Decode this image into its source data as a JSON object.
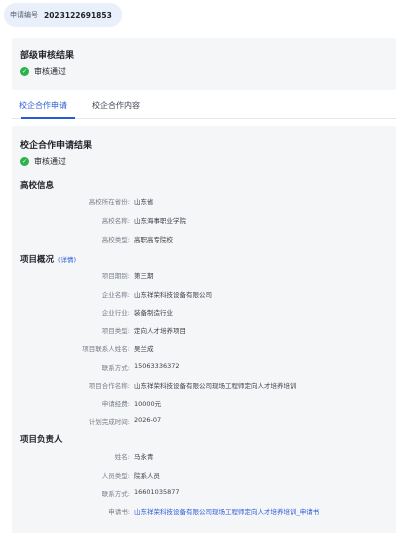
{
  "header": {
    "app_label": "申请编号",
    "app_number": "2023122691853"
  },
  "dept_review": {
    "title": "部级审核结果",
    "status": "审核通过"
  },
  "tabs": [
    {
      "label": "校企合作申请",
      "active": true
    },
    {
      "label": "校企合作内容",
      "active": false
    }
  ],
  "application": {
    "result_title": "校企合作申请结果",
    "result_status": "审核通过",
    "school_section": {
      "title": "高校信息",
      "fields": [
        {
          "label": "高校所在省份:",
          "value": "山东省"
        },
        {
          "label": "高校名称:",
          "value": "山东海事职业学院"
        },
        {
          "label": "高校类型:",
          "value": "高职高专院校"
        }
      ]
    },
    "project_section": {
      "title": "项目概况",
      "link": "(详情)",
      "fields": [
        {
          "label": "项目期别:",
          "value": "第三期"
        },
        {
          "label": "企业名称:",
          "value": "山东祥荣科技设备有限公司"
        },
        {
          "label": "企业行业:",
          "value": "装备制造行业"
        },
        {
          "label": "项目类型:",
          "value": "定向人才培养项目"
        },
        {
          "label": "项目联系人姓名:",
          "value": "吴兰成"
        },
        {
          "label": "联系方式:",
          "value": "15063336372"
        },
        {
          "label": "项目合作名称:",
          "value": "山东祥荣科技设备有限公司现场工程师定向人才培养培训"
        },
        {
          "label": "申请经费:",
          "value": "10000元"
        },
        {
          "label": "计划完成时间:",
          "value": "2026-07"
        }
      ]
    },
    "lead_section": {
      "title": "项目负责人",
      "fields": [
        {
          "label": "姓名:",
          "value": "马永青"
        },
        {
          "label": "人员类型:",
          "value": "院系人员"
        },
        {
          "label": "联系方式:",
          "value": "16601035877"
        },
        {
          "label": "申请书:",
          "value": "山东祥荣科技设备有限公司现场工程师定向人才培养培训_申请书"
        }
      ]
    }
  }
}
